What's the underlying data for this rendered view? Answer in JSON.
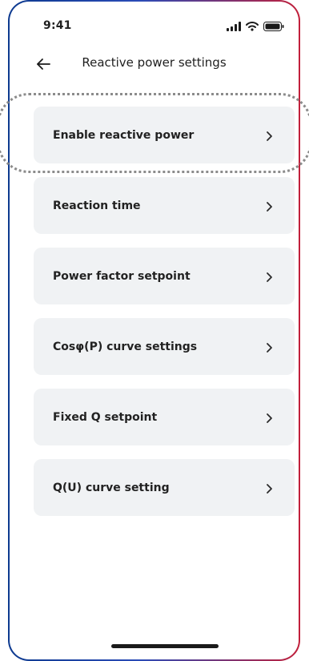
{
  "status_bar": {
    "time": "9:41",
    "icons": [
      "signal-icon",
      "wifi-icon",
      "battery-icon"
    ]
  },
  "header": {
    "title": "Reactive power  settings",
    "back_icon": "back-arrow-icon"
  },
  "menu": {
    "items": [
      {
        "label": "Enable reactive power",
        "chevron": ">"
      },
      {
        "label": "Reaction time",
        "chevron": ">"
      },
      {
        "label": "Power factor setpoint",
        "chevron": ">"
      },
      {
        "label": "Cosφ(P) curve settings",
        "chevron": ">"
      },
      {
        "label": "Fixed Q setpoint",
        "chevron": ">"
      },
      {
        "label": "Q(U) curve setting",
        "chevron": ">"
      }
    ],
    "highlighted_index": 0
  },
  "colors": {
    "card_background": "#f0f2f4",
    "frame_gradient_start": "#0d3a8f",
    "frame_gradient_end": "#c21f3a",
    "highlight_outline": "#8b8b8b",
    "text": "#222222"
  }
}
